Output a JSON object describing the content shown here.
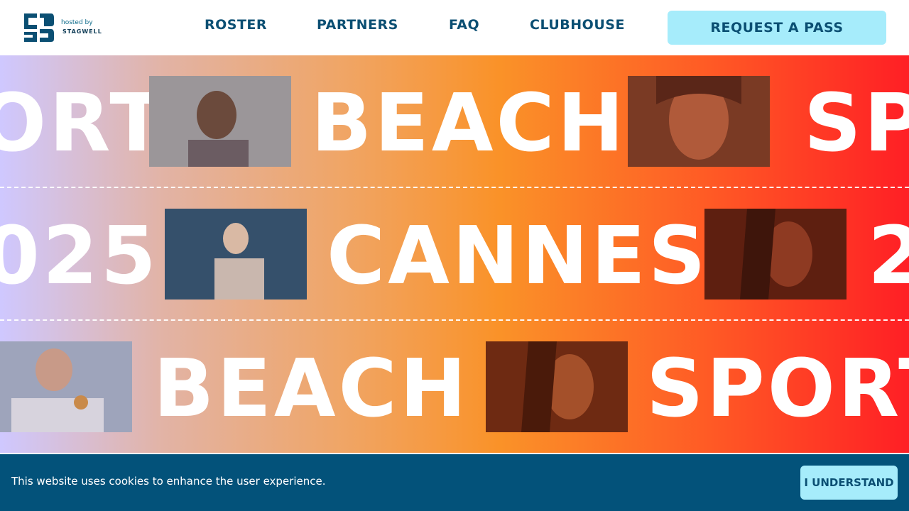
{
  "header": {
    "hosted_by": "hosted by",
    "host_brand": "STAGWELL",
    "nav": [
      {
        "label": "ROSTER"
      },
      {
        "label": "PARTNERS"
      },
      {
        "label": "FAQ"
      },
      {
        "label": "CLUBHOUSE"
      }
    ],
    "cta_label": "REQUEST A PASS"
  },
  "hero": {
    "rows": [
      {
        "words": [
          "ORT",
          "BEACH",
          "SP"
        ]
      },
      {
        "words": [
          "025",
          "CANNES",
          "2"
        ]
      },
      {
        "words": [
          "BEACH",
          "SPORT"
        ]
      }
    ]
  },
  "cookie": {
    "message": "This website uses cookies to enhance the user experience.",
    "button_label": "I UNDERSTAND"
  },
  "colors": {
    "brand_navy": "#0b4f73",
    "cta_bg": "#a6ecfb",
    "cookie_bg": "#03527a"
  }
}
